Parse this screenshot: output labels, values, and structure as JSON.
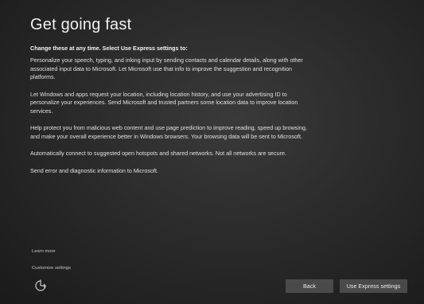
{
  "page": {
    "title": "Get going fast",
    "subtitle": "Change these at any time. Select Use Express settings to:"
  },
  "paragraphs": [
    "Personalize your speech, typing, and inking input by sending contacts and calendar details, along with other associated input data to Microsoft. Let Microsoft use that info to improve the suggestion and recognition platforms.",
    "Let Windows and apps request your location, including location history, and use your advertising ID to personalize your experiences. Send Microsoft and trusted partners some location data to improve location services.",
    "Help protect you from malicious web content and use page prediction to improve reading, speed up browsing, and make your overall experience better in Windows browsers. Your browsing data will be sent to Microsoft.",
    "Automatically connect to suggested open hotspots and shared networks. Not all networks are secure.",
    "Send error and diagnostic information to Microsoft."
  ],
  "links": {
    "learn_more": "Learn more",
    "customize": "Customize settings"
  },
  "buttons": {
    "back": "Back",
    "express": "Use Express settings"
  },
  "icons": {
    "ease_of_access": "ease-of-access-icon"
  },
  "colors": {
    "background": "#2b2b2b",
    "button": "#4a4a4a",
    "text": "#e6e6e6"
  }
}
